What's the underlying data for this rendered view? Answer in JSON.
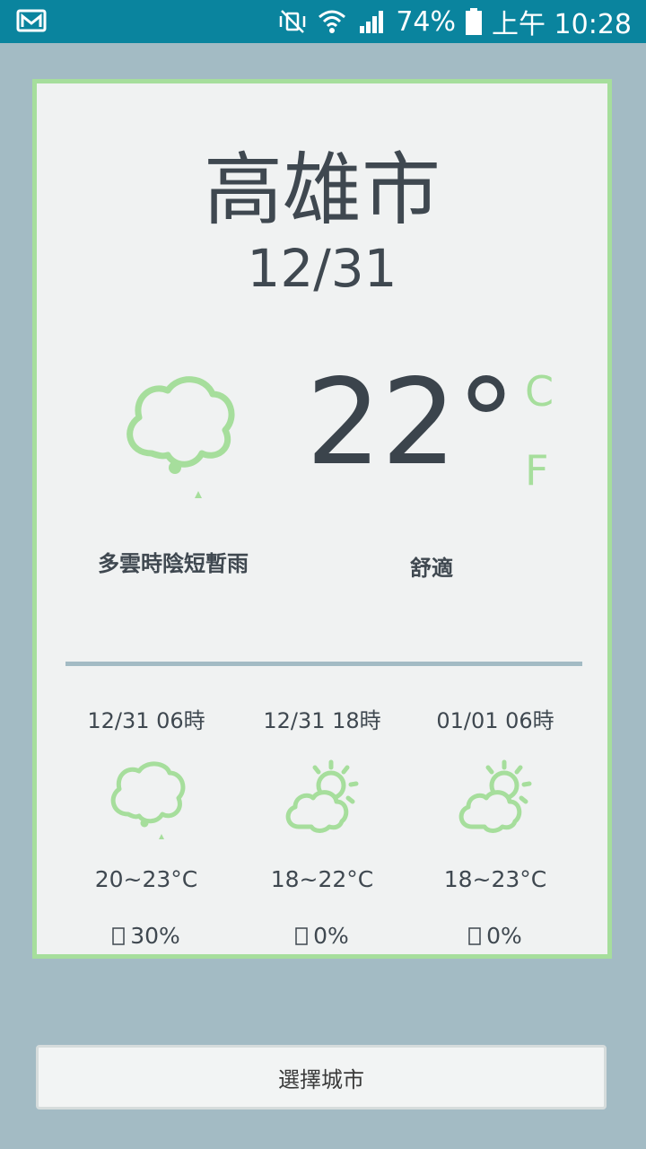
{
  "status_bar": {
    "battery": "74%",
    "time": "上午 10:28",
    "icons": [
      "gmail-icon",
      "mute-vibrate-icon",
      "wifi-icon",
      "signal-icon",
      "battery-icon"
    ]
  },
  "weather": {
    "city": "高雄市",
    "date": "12/31",
    "temperature": "22°",
    "unit_c": "C",
    "unit_f": "F",
    "description": "多雲時陰短暫雨",
    "comfort": "舒適",
    "icon": "cloudy-rain-icon"
  },
  "forecast": [
    {
      "time": "12/31 06時",
      "icon": "cloudy-rain-icon",
      "temp": "20~23°C",
      "rain": "30%"
    },
    {
      "time": "12/31 18時",
      "icon": "partly-cloudy-night-icon",
      "temp": "18~22°C",
      "rain": "0%"
    },
    {
      "time": "01/01 06時",
      "icon": "partly-cloudy-icon",
      "temp": "18~23°C",
      "rain": "0%"
    }
  ],
  "select_city_button": "選擇城市",
  "colors": {
    "accent": "#a6de9c",
    "background": "#a3bbc4",
    "status_bar": "#0a849e",
    "text": "#3f4850"
  }
}
